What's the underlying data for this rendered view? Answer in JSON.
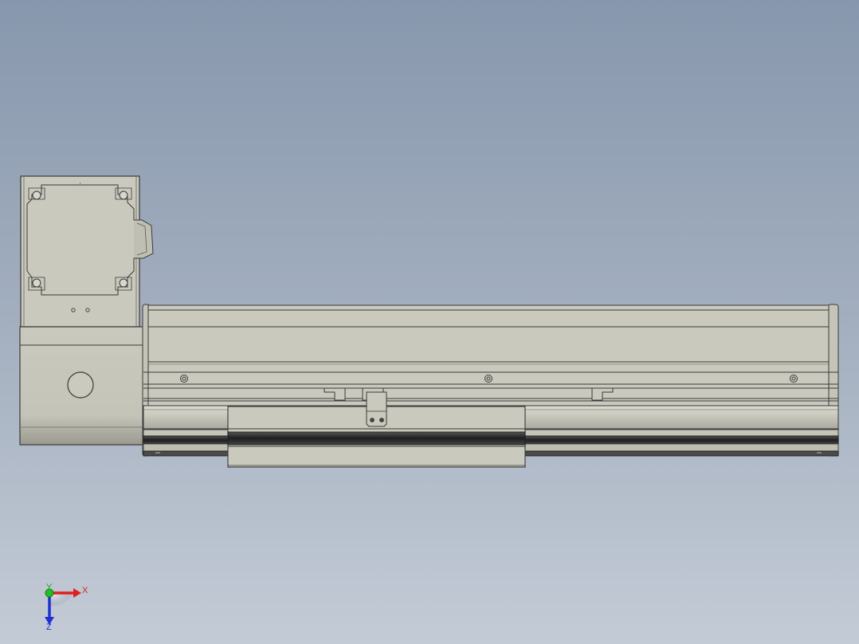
{
  "viewport": {
    "background_top": "#8797ad",
    "background_bottom": "#c3cbd6"
  },
  "model": {
    "body_color": "#c9c9bd",
    "edge_color": "#3a3a3a",
    "rail_dark_color": "#2a2a2a"
  },
  "triad": {
    "x_label": "X",
    "y_label": "Y",
    "z_label": "Z",
    "x_color": "#e02020",
    "y_color": "#20c020",
    "z_color": "#2030d0"
  }
}
